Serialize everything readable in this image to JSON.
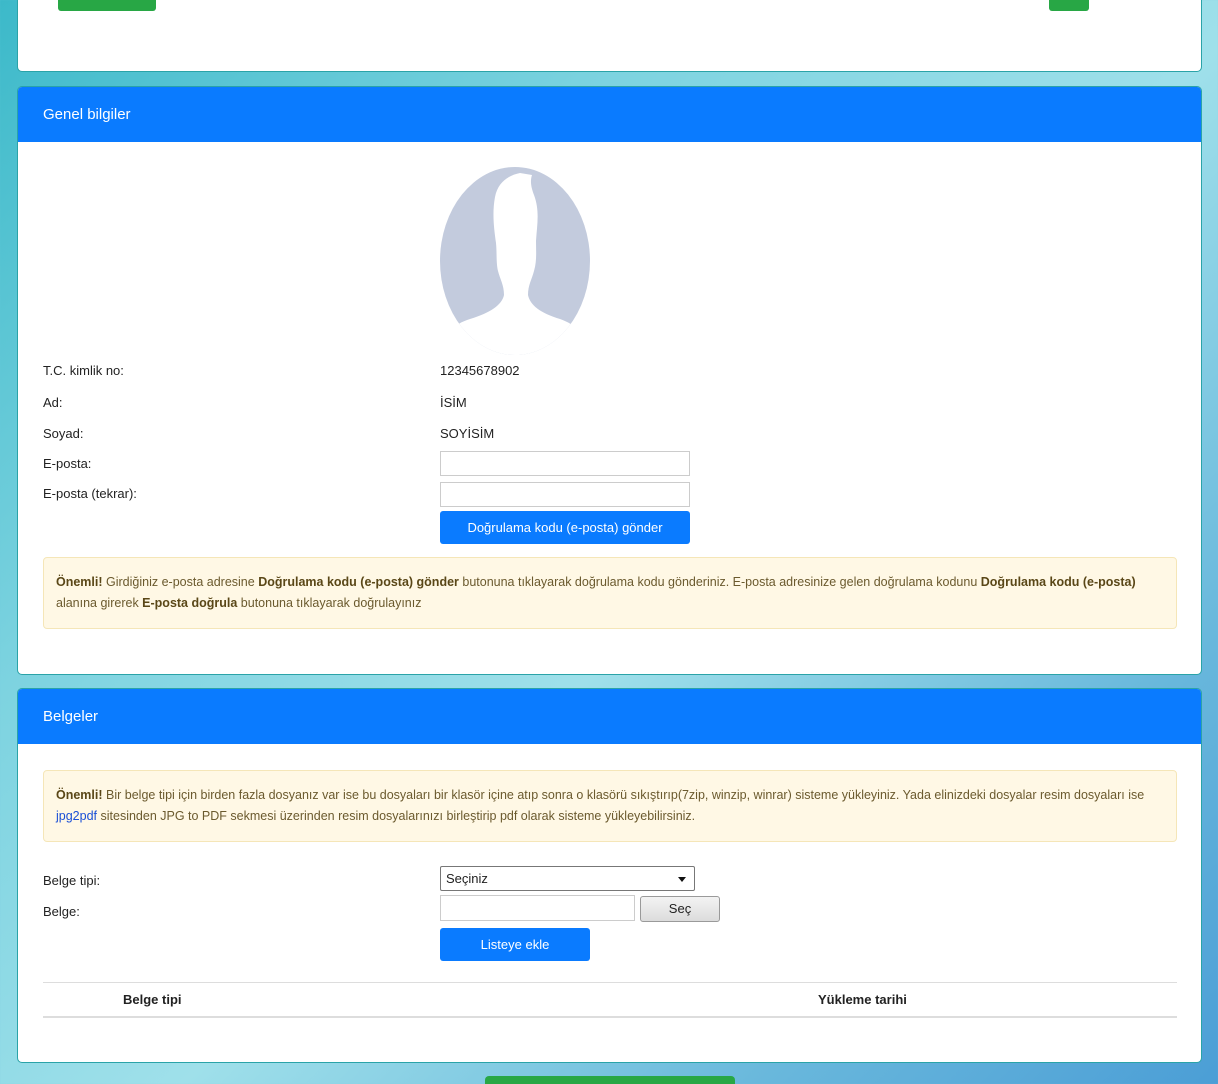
{
  "colors": {
    "primary": "#0a7bff",
    "success": "#28a745",
    "alert_bg": "#fff8e5"
  },
  "general": {
    "title": "Genel bilgiler",
    "avatar_icon": "user-silhouette-icon",
    "fields": {
      "tc_label": "T.C. kimlik no:",
      "tc_value": "12345678902",
      "ad_label": "Ad:",
      "ad_value": "İSİM",
      "soyad_label": "Soyad:",
      "soyad_value": "SOYİSİM",
      "email_label": "E-posta:",
      "email_value": "",
      "email_repeat_label": "E-posta (tekrar):",
      "email_repeat_value": ""
    },
    "send_code_button": "Doğrulama kodu (e-posta) gönder",
    "alert": {
      "strong": "Önemli!",
      "t1": " Girdiğiniz e-posta adresine ",
      "b1": "Doğrulama kodu (e-posta) gönder",
      "t2": " butonuna tıklayarak doğrulama kodu gönderiniz. E-posta adresinize gelen doğrulama kodunu ",
      "b2": "Doğrulama kodu (e-posta)",
      "t3": " alanına girerek ",
      "b3": "E-posta doğrula",
      "t4": " butonuna tıklayarak doğrulayınız"
    }
  },
  "documents": {
    "title": "Belgeler",
    "alert": {
      "strong": "Önemli!",
      "t1": " Bir belge tipi için birden fazla dosyanız var ise bu dosyaları bir klasör içine atıp sonra o klasörü sıkıştırıp(7zip, winzip, winrar) sisteme yükleyiniz. Yada elinizdeki dosyalar resim dosyaları ise ",
      "link": "jpg2pdf",
      "t2": " sitesinden JPG to PDF sekmesi üzerinden resim dosyalarınızı birleştirip pdf olarak sisteme yükleyebilirsiniz."
    },
    "type_label": "Belge tipi:",
    "type_selected": "Seçiniz",
    "file_label": "Belge:",
    "browse_button": "Seç",
    "add_button": "Listeye ekle",
    "table_headers": [
      "Belge tipi",
      "Yükleme tarihi"
    ]
  }
}
